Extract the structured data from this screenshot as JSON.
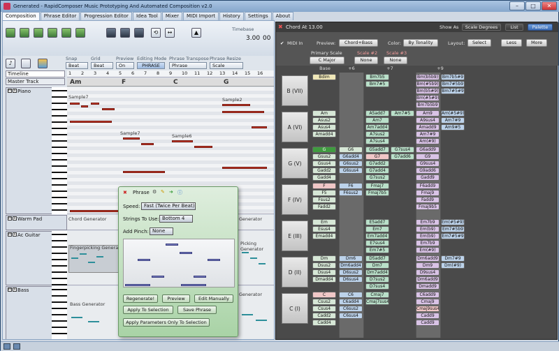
{
  "window": {
    "title": "Generated - RapidComposer Music Prototyping And Automated Composition v2.0"
  },
  "tabs": [
    "Composition",
    "Phrase Editor",
    "Progression Editor",
    "Idea Tool",
    "Mixer",
    "MIDI Import",
    "History",
    "Settings",
    "About"
  ],
  "toolbar": {
    "timebase_label": "Timebase",
    "tempo": "3.00",
    "bars": "00",
    "snap": {
      "label": "Snap",
      "value": "Beat"
    },
    "grid": {
      "label": "Grid",
      "value": "Beat"
    },
    "preview": {
      "label": "Preview",
      "value": "On"
    },
    "editing_mode": {
      "label": "Editing Mode",
      "value": "PHRASE"
    },
    "phrase_transpose": {
      "label": "Phrase Transpose",
      "value": "Phrase"
    },
    "phrase_resize": {
      "label": "Phrase Resize",
      "value": "Scale"
    }
  },
  "timeline": {
    "label": "Timeline",
    "master": "Master Track",
    "bars": [
      "1",
      "2",
      "3",
      "4",
      "5",
      "6",
      "7",
      "8",
      "9",
      "10",
      "11",
      "12",
      "13",
      "14",
      "15",
      "16"
    ],
    "chords": [
      "Am",
      "F",
      "C",
      "G"
    ]
  },
  "tracks": [
    {
      "name": "Piano",
      "notes_label1": "Sample7",
      "notes_label2": "Sample7",
      "notes_label3": "Sample6",
      "notes_label4": "Sample2"
    },
    {
      "name": "Warm Pad",
      "gen": "Chord Generator",
      "gen2": "Generator"
    },
    {
      "name": "Ac Guitar",
      "gen": "Fingerpicking Generator",
      "gen2": "Picking Generator"
    },
    {
      "name": "Bass",
      "gen": "Bass Generator",
      "gen2": "Generator"
    }
  ],
  "phrase_popup": {
    "title": "Phrase",
    "speed_label": "Speed:",
    "speed_value": "Fast (Twice Per Beat)",
    "strings_label": "Strings To Use:",
    "strings_value": "Bottom 4",
    "pinch_label": "Add Pinch:",
    "pinch_value": "None",
    "buttons": [
      "Regenerate!",
      "Preview",
      "Edit Manually",
      "Apply To Selection",
      "Save Phrase",
      "Apply Parameters Only To Selection"
    ]
  },
  "chord_panel": {
    "title": "Chord At 13.00",
    "show_as_label": "Show As",
    "show_as_value": "Scale Degrees",
    "list_btn": "List",
    "palette_btn": "Palette",
    "midi_in": "MIDI In",
    "preview_label": "Preview:",
    "preview_value": "Chord+Bass",
    "color_label": "Color:",
    "color_value": "By Tonality",
    "layout_label": "Layout:",
    "layout_value": "Select",
    "less_btn": "Less",
    "more_btn": "More",
    "primary_scale_label": "Primary Scale",
    "primary_scale_value": "C Major",
    "scale2_label": "Scale #2",
    "scale2_value": "None",
    "scale3_label": "Scale #3",
    "scale3_value": "None",
    "col_headers": [
      "Base",
      "+6",
      "+7",
      "+9"
    ],
    "degrees": [
      "B (VII)",
      "A (VI)",
      "G (V)",
      "F (IV)",
      "E (III)",
      "D (II)",
      "C (I)"
    ],
    "rows": [
      {
        "base": [
          "Bdim"
        ],
        "p6": [],
        "p7": [
          "Bm7b5",
          "Bm7#5"
        ],
        "p9": [
          "Bm(b5b9)",
          "Bm(#5b9)",
          "Bm(b5#9)",
          "Bm(#5#9)",
          "Bm7b5b9"
        ],
        "p9b": [
          "Bm7b5#9",
          "Bm7#5b9",
          "Bm7#5#9"
        ]
      },
      {
        "base": [
          "Am",
          "Asus2",
          "Asus4",
          "Amadd4"
        ],
        "p6": [],
        "p7": [
          "A5add7",
          "Am7",
          "Am7add4",
          "A7sus2",
          "A7sus4"
        ],
        "p7b": [
          "Am7#5"
        ],
        "p9": [
          "Am9",
          "A9sus4",
          "Amadd9",
          "Am7#9",
          "Am(#9)"
        ],
        "p9b": [
          "Am(#5#9)",
          "Am7#9",
          "Am9#5"
        ]
      },
      {
        "base": [
          "G",
          "Gsus2",
          "Gsus4",
          "Gadd2",
          "Gadd4"
        ],
        "p6": [
          "G6",
          "G6add4",
          "G6sus2",
          "G6sus4"
        ],
        "p7": [
          "G5add7",
          "G7",
          "G7add2",
          "G7add4",
          "G7sus2"
        ],
        "p7b": [
          "G7sus4",
          "G7add6"
        ],
        "p9": [
          "G6add9",
          "G9",
          "G9sus4",
          "G9add6",
          "Gadd9"
        ],
        "p9b": []
      },
      {
        "base": [
          "F",
          "F5",
          "Fsus2",
          "Fadd2"
        ],
        "p6": [
          "F6",
          "F6sus2"
        ],
        "p7": [
          "Fmaj7",
          "Fmaj7b5"
        ],
        "p9": [
          "F6add9",
          "Fmaj9",
          "Fadd9",
          "Fmaj9b5"
        ],
        "p9b": []
      },
      {
        "base": [
          "Em",
          "Esus4",
          "Emadd4"
        ],
        "p6": [],
        "p7": [
          "E5add7",
          "Em7",
          "Em7add4",
          "E7sus4",
          "Em7#5"
        ],
        "p9": [
          "Em7b9",
          "Em(b9)",
          "Em(b9)",
          "Em7b9",
          "Em(#9)"
        ],
        "p9b": [
          "Em(#5#9)",
          "Em7#5b9",
          "Em7#5#9"
        ]
      },
      {
        "base": [
          "Dm",
          "Dsus2",
          "Dsus4",
          "Dmadd4"
        ],
        "p6": [
          "Dm6",
          "Dm6add4",
          "D6sus2",
          "D6sus4"
        ],
        "p7": [
          "D5add7",
          "Dm7",
          "Dm7add4",
          "D7sus2",
          "D7sus4"
        ],
        "p9": [
          "Dm6add9",
          "Dm9",
          "D9sus4",
          "Dm6add9",
          "Dmadd9"
        ],
        "p9b": [
          "Dm7#9",
          "Dm(#9)"
        ]
      },
      {
        "base": [
          "C",
          "Csus2",
          "Csus4",
          "Cadd2",
          "Cadd4"
        ],
        "p6": [
          "C6",
          "C6add4",
          "C6sus2",
          "C6sus4"
        ],
        "p7": [
          "Cmaj7",
          "Cmaj7sus4"
        ],
        "p9": [
          "C6add9",
          "Cmaj9",
          "Cmaj9sus4",
          "Cadd9",
          "Cadd9"
        ],
        "p9b": []
      }
    ]
  },
  "colors": {
    "accent": "#3a6ab2",
    "note": "#c0392b",
    "selected": "#3f9b3f"
  }
}
